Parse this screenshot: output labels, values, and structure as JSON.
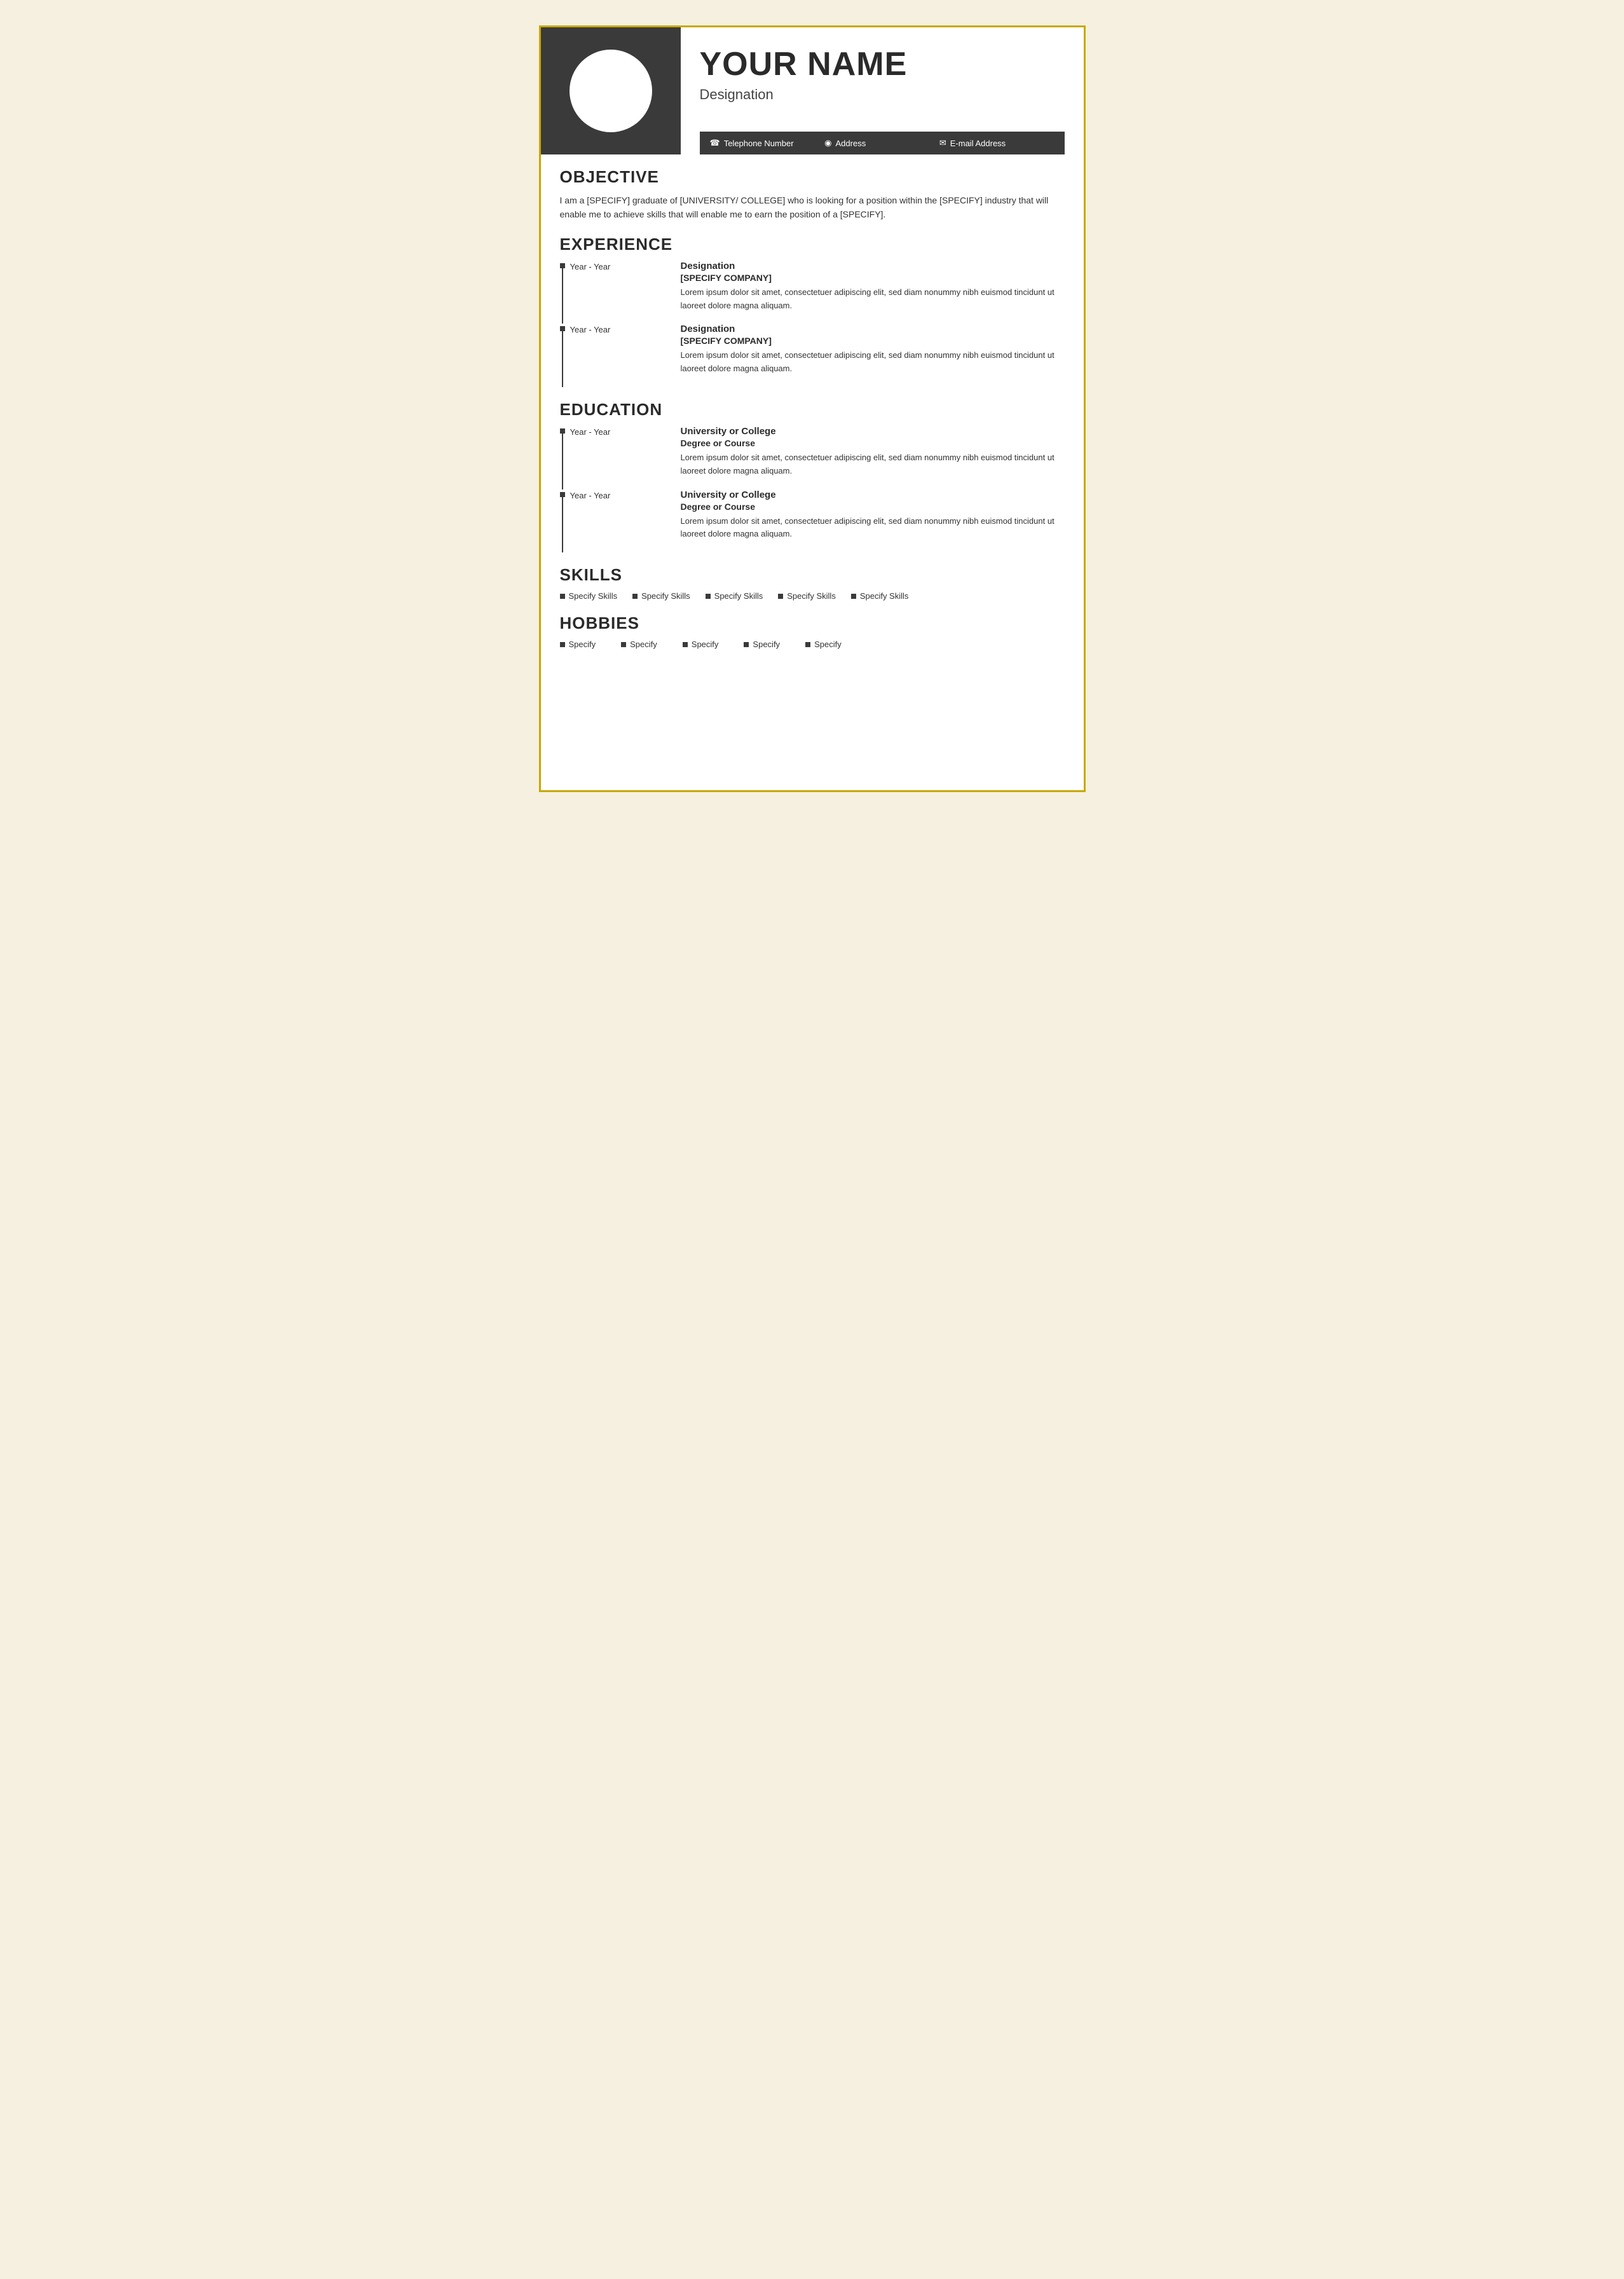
{
  "border_color": "#c8a800",
  "header": {
    "name": "YOUR NAME",
    "designation": "Designation",
    "contact": {
      "phone_icon": "☎",
      "phone": "Telephone Number",
      "address_icon": "◉",
      "address": "Address",
      "email_icon": "✉",
      "email": "E-mail Address"
    }
  },
  "objective": {
    "label": "OBJECTIVE",
    "text": "I am a [SPECIFY] graduate of [UNIVERSITY/ COLLEGE] who is looking for a position within the [SPECIFY] industry that will enable me to achieve skills that will enable me to earn the position of a [SPECIFY]."
  },
  "experience": {
    "label": "EXPERIENCE",
    "entries": [
      {
        "years": "Year - Year",
        "designation": "Designation",
        "company": "[SPECIFY COMPANY]",
        "description": "Lorem ipsum dolor sit amet, consectetuer adipiscing elit, sed diam nonummy nibh euismod tincidunt ut laoreet dolore magna aliquam."
      },
      {
        "years": "Year - Year",
        "designation": "Designation",
        "company": "[SPECIFY COMPANY]",
        "description": "Lorem ipsum dolor sit amet, consectetuer adipiscing elit, sed diam nonummy nibh euismod tincidunt ut laoreet dolore magna aliquam."
      }
    ]
  },
  "education": {
    "label": "EDUCATION",
    "entries": [
      {
        "years": "Year - Year",
        "institution": "University or College",
        "degree": "Degree or Course",
        "description": "Lorem ipsum dolor sit amet, consectetuer adipiscing elit, sed diam nonummy nibh euismod tincidunt ut laoreet dolore magna aliquam."
      },
      {
        "years": "Year - Year",
        "institution": "University or College",
        "degree": "Degree or Course",
        "description": "Lorem ipsum dolor sit amet, consectetuer adipiscing elit, sed diam nonummy nibh euismod tincidunt ut laoreet dolore magna aliquam."
      }
    ]
  },
  "skills": {
    "label": "SKILLS",
    "items": [
      "Specify Skills",
      "Specify Skills",
      "Specify Skills",
      "Specify Skills",
      "Specify Skills"
    ]
  },
  "hobbies": {
    "label": "HOBBIES",
    "items": [
      "Specify",
      "Specify",
      "Specify",
      "Specify",
      "Specify"
    ]
  }
}
